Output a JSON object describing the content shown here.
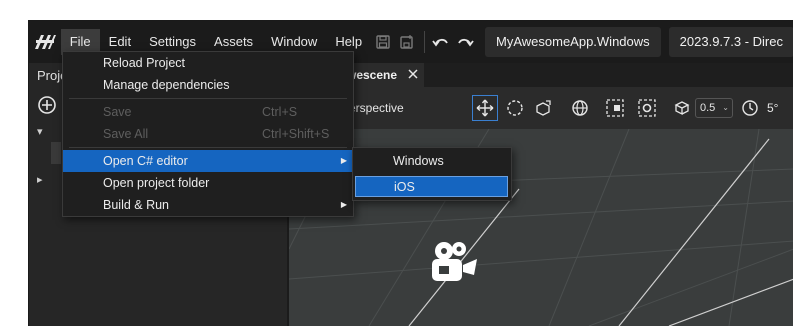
{
  "menubar": {
    "items": [
      "File",
      "Edit",
      "Settings",
      "Assets",
      "Window",
      "Help"
    ],
    "active": "File",
    "project_selector": "MyAwesomeApp.Windows",
    "version_selector": "2023.9.7.3 - Direc"
  },
  "left_panel": {
    "tab_label": "Proje"
  },
  "scene": {
    "tab_label": "wescene",
    "view_mode": "erspective",
    "snap_value": "0.5",
    "rotation_snap": "5°"
  },
  "file_menu": {
    "items": [
      {
        "label": "Reload Project",
        "shortcut": "",
        "enabled": true,
        "submenu": false
      },
      {
        "label": "Manage dependencies",
        "shortcut": "",
        "enabled": true,
        "submenu": false
      },
      {
        "label": "Save",
        "shortcut": "Ctrl+S",
        "enabled": false,
        "submenu": false
      },
      {
        "label": "Save All",
        "shortcut": "Ctrl+Shift+S",
        "enabled": false,
        "submenu": false
      },
      {
        "label": "Open C# editor",
        "shortcut": "",
        "enabled": true,
        "submenu": true,
        "highlighted": true
      },
      {
        "label": "Open project folder",
        "shortcut": "",
        "enabled": true,
        "submenu": false
      },
      {
        "label": "Build & Run",
        "shortcut": "",
        "enabled": true,
        "submenu": true
      }
    ]
  },
  "csharp_submenu": {
    "items": [
      {
        "label": "Windows",
        "highlighted": false
      },
      {
        "label": "iOS",
        "highlighted": true
      }
    ]
  },
  "colors": {
    "menubar_bg": "#1b1b1b",
    "highlight": "#1565c0",
    "disabled_text": "#5e5e5e",
    "viewport_bg": "#3a3d3d"
  }
}
